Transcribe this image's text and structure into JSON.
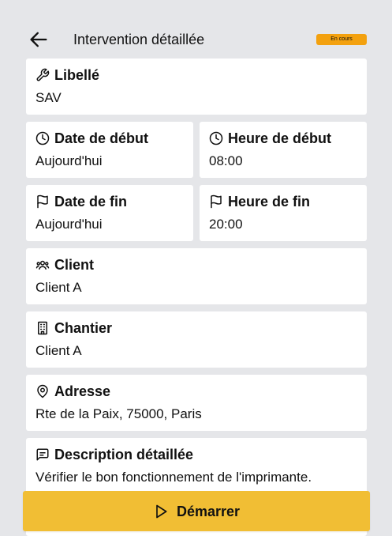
{
  "header": {
    "title": "Intervention détaillée",
    "status": "En cours",
    "status_color": "#f3a10f"
  },
  "fields": {
    "libelle": {
      "label": "Libellé",
      "value": "SAV",
      "icon": "wrench-icon"
    },
    "date_debut": {
      "label": "Date de début",
      "value": "Aujourd'hui",
      "icon": "clock-icon"
    },
    "heure_debut": {
      "label": "Heure de début",
      "value": "08:00",
      "icon": "clock-icon"
    },
    "date_fin": {
      "label": "Date de fin",
      "value": "Aujourd'hui",
      "icon": "flag-icon"
    },
    "heure_fin": {
      "label": "Heure de fin",
      "value": "20:00",
      "icon": "flag-icon"
    },
    "client": {
      "label": "Client",
      "value": "Client A",
      "icon": "users-icon"
    },
    "chantier": {
      "label": "Chantier",
      "value": "Client A",
      "icon": "building-icon"
    },
    "adresse": {
      "label": "Adresse",
      "value": "Rte de la Paix, 75000, Paris",
      "icon": "map-pin-icon"
    },
    "description": {
      "label": "Description détaillée",
      "value": "Vérifier le bon fonctionnement de l'imprimante.",
      "icon": "message-icon"
    }
  },
  "actions": {
    "start_label": "Démarrer",
    "start_icon": "play-icon",
    "start_color": "#f1be34"
  }
}
